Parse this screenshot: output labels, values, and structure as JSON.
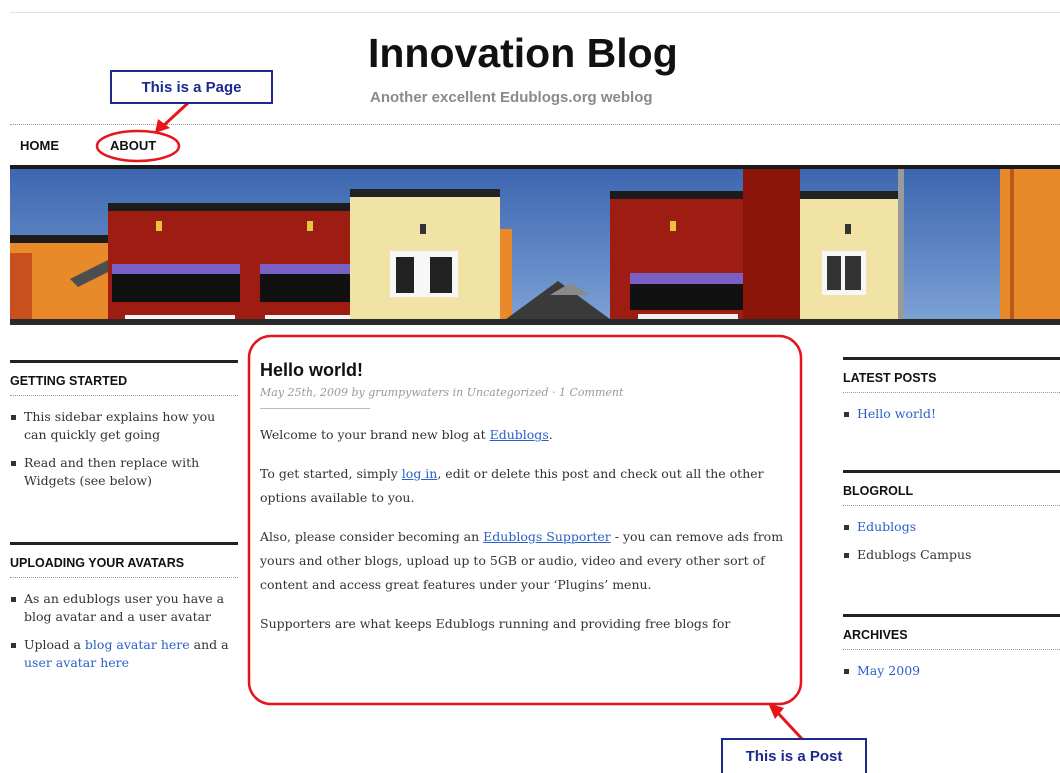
{
  "site": {
    "title": "Innovation Blog",
    "description": "Another excellent Edublogs.org weblog"
  },
  "nav": {
    "home": "HOME",
    "about": "ABOUT"
  },
  "annotations": {
    "page_label": "This is a Page",
    "post_label": "This is a Post",
    "annotation_color": "#1c2a8c",
    "highlight_color": "#e8141c"
  },
  "left_sidebar": {
    "getting_started": {
      "title": "GETTING STARTED",
      "items": [
        "This sidebar explains how you can quickly get going",
        "Read and then replace with Widgets (see below)"
      ]
    },
    "avatars": {
      "title": "UPLOADING YOUR AVATARS",
      "item1": "As an edublogs user you have a blog avatar and a user avatar",
      "item2_prefix": "Upload a ",
      "item2_link1": "blog avatar here",
      "item2_middle": " and a ",
      "item2_link2": "user avatar here"
    }
  },
  "post": {
    "title": "Hello world!",
    "meta": "May 25th, 2009 by grumpywaters in Uncategorized · 1 Comment",
    "p1_prefix": "Welcome to your brand new blog at ",
    "p1_link": "Edublogs",
    "p1_suffix": ".",
    "p2_prefix": "To get started, simply ",
    "p2_link": "log in",
    "p2_suffix": ", edit or delete this post and check out all the other options available to you.",
    "p3_prefix": "Also, please consider becoming an ",
    "p3_link": "Edublogs Supporter",
    "p3_suffix": " - you can remove ads from yours and other blogs, upload up to 5GB or audio, video and every other sort of content and access great features under your ‘Plugins’ menu.",
    "p4": "Supporters are what keeps Edublogs running and providing free blogs for"
  },
  "right_sidebar": {
    "latest_posts": {
      "title": "LATEST POSTS",
      "items": [
        "Hello world!"
      ]
    },
    "blogroll": {
      "title": "BLOGROLL",
      "items": [
        "Edublogs",
        "Edublogs Campus"
      ]
    },
    "archives": {
      "title": "ARCHIVES",
      "items": [
        "May 2009"
      ]
    }
  },
  "colors": {
    "link": "#2a5fc7",
    "text": "#333333",
    "heading": "#111111"
  }
}
